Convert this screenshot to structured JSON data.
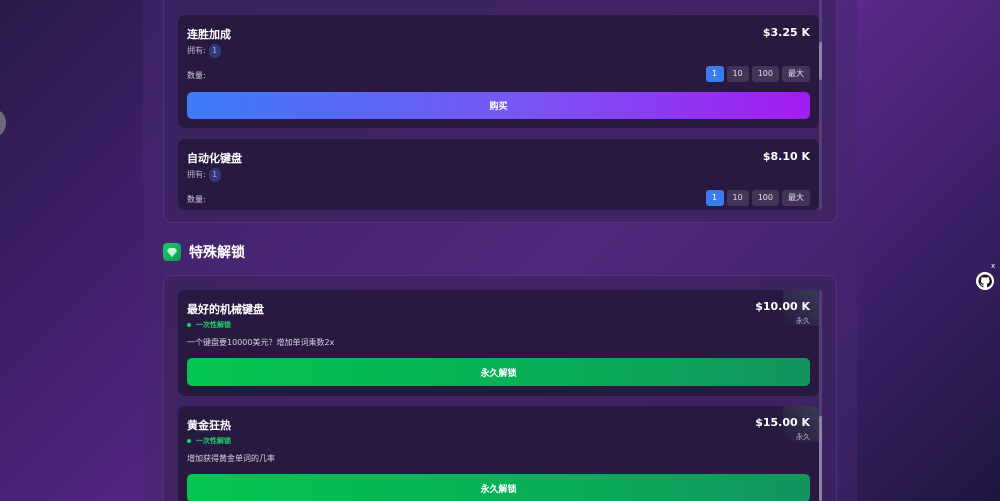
{
  "upgrades": [
    {
      "title": "连胜加成",
      "price": "$3.25 K",
      "owned_label": "拥有:",
      "owned_count": "1",
      "qty_label": "数量:",
      "qty_options": [
        "1",
        "10",
        "100",
        "最大"
      ],
      "buy_label": "购买"
    },
    {
      "title": "自动化键盘",
      "price": "$8.10 K",
      "owned_label": "拥有:",
      "owned_count": "1",
      "qty_label": "数量:",
      "qty_options": [
        "1",
        "10",
        "100",
        "最大"
      ]
    }
  ],
  "special_section": {
    "title": "特殊解锁",
    "icon": "gem-icon",
    "items": [
      {
        "title": "最好的机械键盘",
        "price": "$10.00 K",
        "price_note": "永久",
        "tag": "一次性解锁",
        "description": "一个键盘要10000美元？增加单词乘数2x",
        "button_label": "永久解锁"
      },
      {
        "title": "黄金狂热",
        "price": "$15.00 K",
        "price_note": "永久",
        "tag": "一次性解锁",
        "description": "增加获得黄金单词的几率",
        "button_label": "永久解锁"
      }
    ]
  },
  "floating": {
    "icon": "github-icon",
    "close_mark": "x"
  },
  "colors": {
    "buy_gradient_start": "#3d7bf7",
    "buy_gradient_end": "#a21cf0",
    "unlock_green": "#04c64e",
    "qty_active": "#3b7bf0",
    "onetime_green": "#19d46a"
  }
}
